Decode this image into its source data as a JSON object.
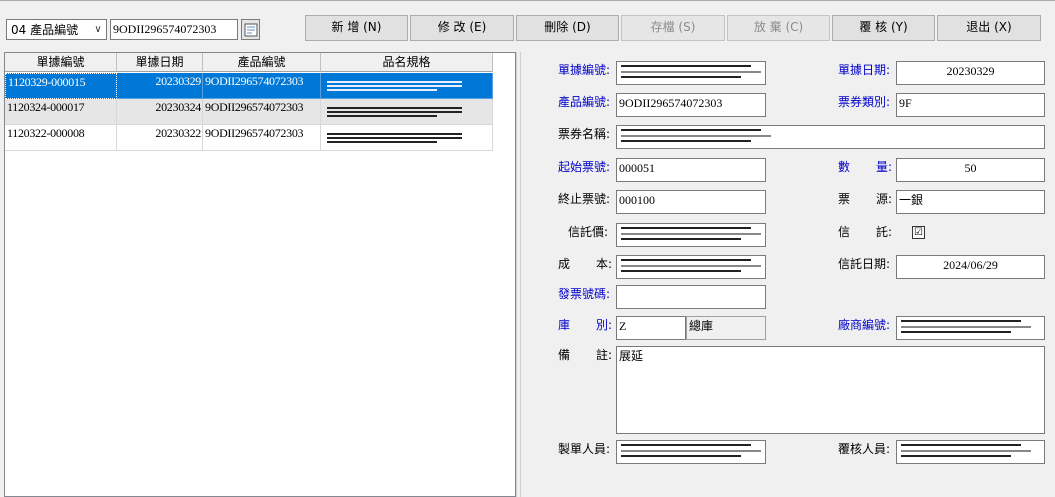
{
  "toolbar": {
    "search_field": "04 產品編號",
    "search_value": "9ODII296574072303",
    "buttons": {
      "new": "新 增 (N)",
      "edit": "修 改 (E)",
      "delete": "刪除 (D)",
      "save": "存檔 (S)",
      "discard": "放 棄 (C)",
      "review": "覆 核 (Y)",
      "exit": "退出 (X)"
    }
  },
  "grid": {
    "columns": [
      "單據編號",
      "單據日期",
      "產品編號",
      "品名規格"
    ],
    "rows": [
      {
        "doc_no": "1120329-000015",
        "date": "20230329",
        "product": "9ODII296574072303"
      },
      {
        "doc_no": "1120324-000017",
        "date": "20230324",
        "product": "9ODII296574072303"
      },
      {
        "doc_no": "1120322-000008",
        "date": "20230322",
        "product": "9ODII296574072303"
      }
    ]
  },
  "form": {
    "doc_no_label": "單據編號:",
    "doc_date_label": "單據日期:",
    "doc_date": "20230329",
    "product_no_label": "產品編號:",
    "product_no": "9ODII296574072303",
    "ticket_type_label": "票券類別:",
    "ticket_type": "9F",
    "ticket_name_label": "票券名稱:",
    "start_no_label": "起始票號:",
    "start_no": "000051",
    "qty_label_1": "數",
    "qty_label_2": "量:",
    "qty": "50",
    "end_no_label": "終止票號:",
    "end_no": "000100",
    "source_label_1": "票",
    "source_label_2": "源:",
    "source": "一銀",
    "trust_price_label": "信託價:",
    "trust_label_1": "信",
    "trust_label_2": "託:",
    "cost_label_1": "成",
    "cost_label_2": "本:",
    "trust_date_label": "信託日期:",
    "trust_date": "2024/06/29",
    "invoice_label": "發票號碼:",
    "warehouse_label_1": "庫",
    "warehouse_label_2": "別:",
    "warehouse_code": "Z",
    "warehouse_name": "總庫",
    "vendor_label": "廠商編號:",
    "remark_label_1": "備",
    "remark_label_2": "註:",
    "remark": "展延",
    "maker_label": "製單人員:",
    "reviewer_label": "覆核人員:",
    "trust_checked": "☑"
  }
}
